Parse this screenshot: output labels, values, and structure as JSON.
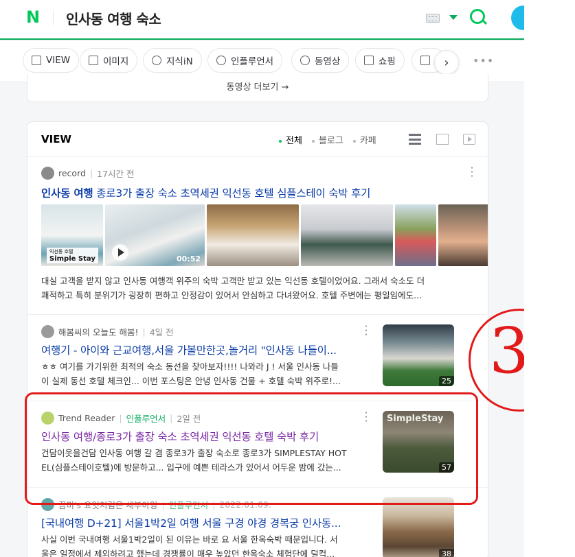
{
  "header": {
    "logo": "N",
    "query": "인사동 여행 숙소"
  },
  "tabs": [
    {
      "label": "VIEW",
      "icon": "document-icon"
    },
    {
      "label": "이미지",
      "icon": "image-icon"
    },
    {
      "label": "지식iN",
      "icon": "q-icon"
    },
    {
      "label": "인플루언서",
      "icon": "person-icon"
    },
    {
      "label": "동영상",
      "icon": "play-icon"
    },
    {
      "label": "쇼핑",
      "icon": "bag-icon"
    },
    {
      "label": "",
      "icon": "news-icon"
    }
  ],
  "prev_section": {
    "more_label": "동영상 더보기 →"
  },
  "view": {
    "title": "VIEW",
    "filters": [
      "전체",
      "블로그",
      "카페"
    ],
    "posts": [
      {
        "author": "record",
        "time": "17시간 전",
        "title_prefix": "인사동 여행",
        "title_rest": " 종로3가 출장 숙소 초역세권 익선동 호텔 심플스테이 숙박 후기",
        "desc_line1": "대실 고객을 받지 않고 인사동 여행객 위주의 숙박 고객만 받고 있는 익선동 호텔이었어요. 그래서 숙소도 더",
        "desc_line2": "쾌적하고 특히 분위기가 굉장히 편하고 안정감이 있어서 안심하고 다녀왔어요. 호텔 주변에는 평일임에도...",
        "thumb_label": "Simple Stay",
        "thumb_sublabel": "익선동 호텔",
        "duration": "00:52"
      },
      {
        "author": "해봄씨의 오늘도 해봄!",
        "time": "4일 전",
        "title": "여행기 - 아이와 근교여행,서울 가볼만한곳,놀거리 \"인사동 나들이...",
        "desc_line1": "ㅎㅎ 여기를 가기위한 최적의 숙소 동선을 찾아보자!!!! 나와라 J ! 서울 인사동 나들",
        "desc_line2": "이 실제 동선 호텔 체크인... 이번 포스팅은 안녕 인사동 건물 + 호텔 숙박 위주로!...",
        "count": "25"
      },
      {
        "author": "Trend Reader",
        "badge": "인플루언서",
        "time": "2일 전",
        "title": "인사동 여행/종로3가 출장 숙소 초역세권 익선동 호텔 숙박 후기",
        "desc_line1": "건담이옷을건담 인사동 여행 갈 겸 종로3가 출장 숙소로 종로3가 SIMPLESTAY HOT",
        "desc_line2": "EL(심플스테이호텔)에 방문하고... 입구에 예쁜 테라스가 있어서 어두운 밤에 갔는...",
        "thumb_text": "SimpleStay",
        "count": "57"
      },
      {
        "author": "끔미's 요잇처럼은 세부아잉",
        "badge": "인플루언서",
        "time": "2022.01.09.",
        "title": "[국내여행 D+21] 서울1박2일 여행 서울 구경 야경 경복궁 인사동...",
        "desc_line1": "사실 이번 국내여행 서울1박2일이 된 이유는 바로 요 서울 한옥숙박 때문입니다. 서",
        "desc_line2": "울은 일정에서 제외하려고 했는데 경쟁률이 매우 높았던 한옥숙소 체험단에 덜컥...",
        "count": "38"
      }
    ]
  },
  "annotation": {
    "number": "3",
    "color": "#e31a1a"
  },
  "colors": {
    "brand": "#03c75a",
    "link": "#0b3ca8",
    "visited": "#7b2aa6",
    "influencer": "#09aa5c"
  }
}
